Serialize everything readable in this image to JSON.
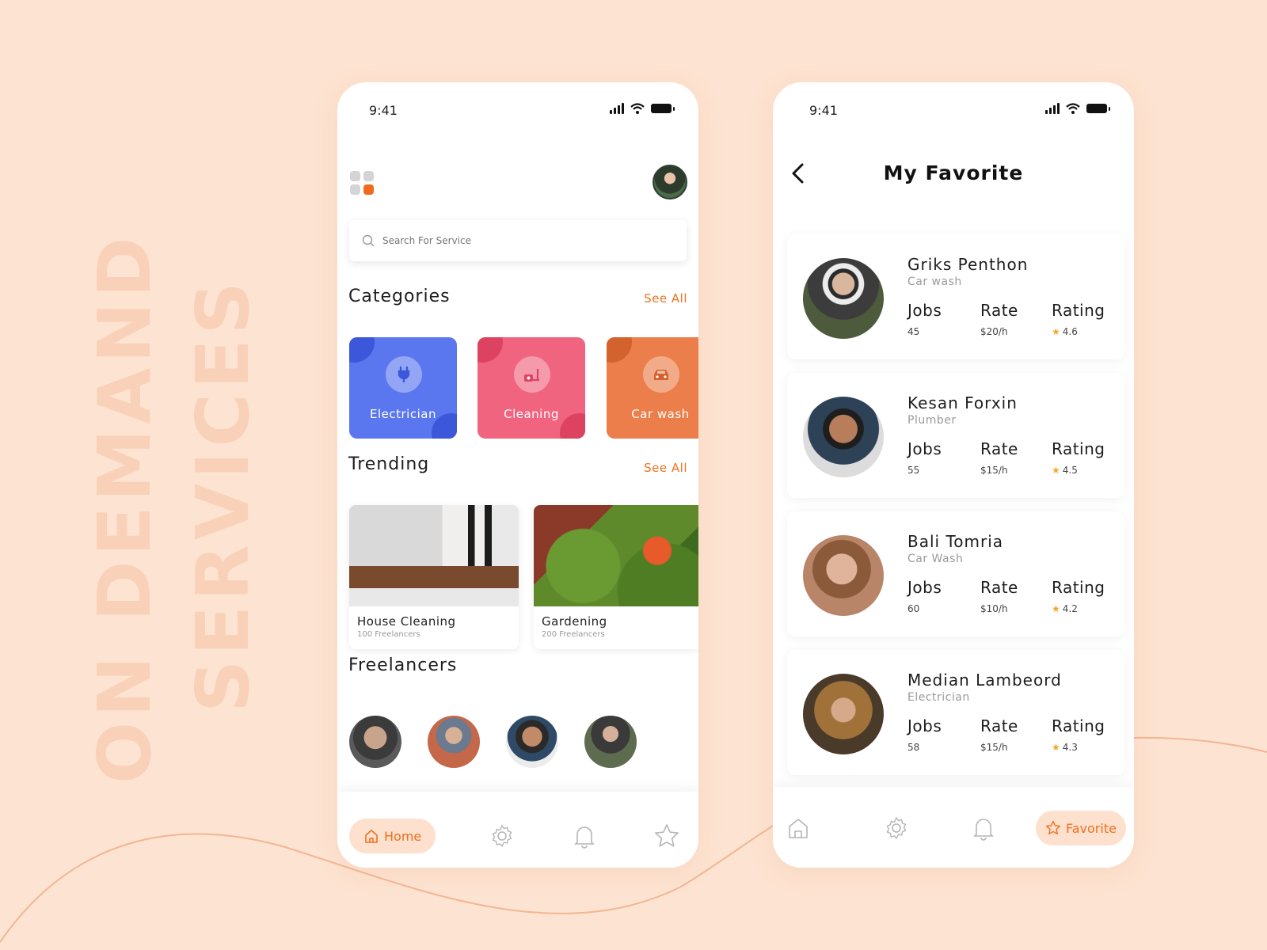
{
  "hero": {
    "line1": "ON DEMAND",
    "line2": "SERVICES"
  },
  "phone1": {
    "time": "9:41",
    "search_placeholder": "Search For Service",
    "categories_title": "Categories",
    "categories_see_all": "See All",
    "categories": [
      {
        "label": "Electrician",
        "color": "#5a77f0",
        "icon": "plug-icon"
      },
      {
        "label": "Cleaning",
        "color": "#f0647f",
        "icon": "vacuum-icon"
      },
      {
        "label": "Car wash",
        "color": "#eb7e4a",
        "icon": "car-icon"
      }
    ],
    "trending_title": "Trending",
    "trending_see_all": "See All",
    "trending": [
      {
        "title": "House Cleaning",
        "subtitle": "100 Freelancers"
      },
      {
        "title": "Gardening",
        "subtitle": "200 Freelancers"
      }
    ],
    "freelancers_title": "Freelancers",
    "tabs": {
      "home": "Home"
    }
  },
  "phone2": {
    "time": "9:41",
    "title": "My Favorite",
    "labels": {
      "jobs": "Jobs",
      "rate": "Rate",
      "rating": "Rating"
    },
    "favorites": [
      {
        "name": "Griks Penthon",
        "role": "Car wash",
        "jobs": "45",
        "rate": "$20/h",
        "rating": "4.6"
      },
      {
        "name": "Kesan Forxin",
        "role": "Plumber",
        "jobs": "55",
        "rate": "$15/h",
        "rating": "4.5"
      },
      {
        "name": "Bali Tomria",
        "role": "Car Wash",
        "jobs": "60",
        "rate": "$10/h",
        "rating": "4.2"
      },
      {
        "name": "Median Lambeord",
        "role": "Electrician",
        "jobs": "58",
        "rate": "$15/h",
        "rating": "4.3"
      }
    ],
    "tabs": {
      "favorite": "Favorite"
    }
  },
  "colors": {
    "accent": "#f0711f",
    "background": "#fde3d1",
    "pill": "#fde0cd"
  }
}
